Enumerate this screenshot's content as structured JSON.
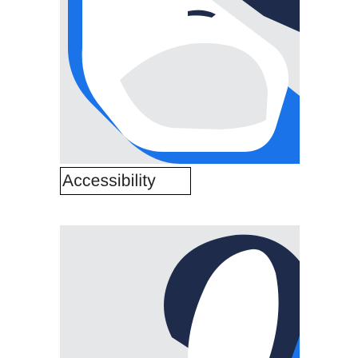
{
  "setting_item": {
    "label": "Accessibility",
    "top_icon": "accessibility-app-icon",
    "bottom_icon": "app-icon-partial"
  },
  "colors": {
    "tile_background": "#e5e7e9",
    "accent_blue": "#1a73e8",
    "dark_navy": "#1e2b4a",
    "text": "#222222",
    "highlight_border": "#000000"
  }
}
